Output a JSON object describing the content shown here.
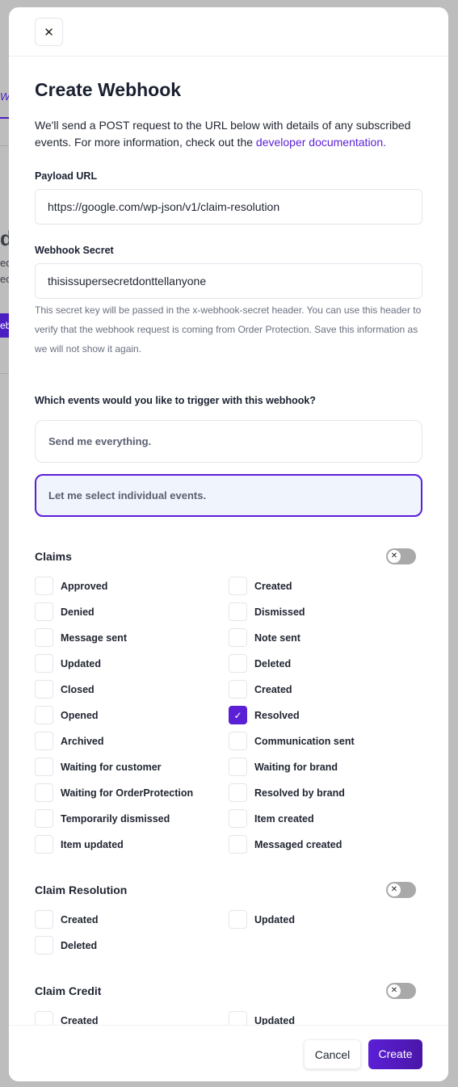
{
  "background": {
    "tab": "We",
    "heading": "d",
    "line1": "ed",
    "line2": "ec",
    "button": "eb"
  },
  "modal": {
    "close_icon": "close-icon",
    "title": "Create Webhook",
    "description": "We'll send a POST request to the URL below with details of any subscribed events. For more information, check out the ",
    "doc_link": "developer documentation.",
    "payload_label": "Payload URL",
    "payload_value": "https://google.com/wp-json/v1/claim-resolution",
    "secret_label": "Webhook Secret",
    "secret_value": "thisissupersecretdonttellanyone",
    "secret_help": "This secret key will be passed in the x-webhook-secret header. You can use this header to verify that the webhook request is coming from Order Protection. Save this information as we will not show it again.",
    "events_question": "Which events would you like to trigger with this webhook?",
    "option_all": "Send me everything.",
    "option_individual": "Let me select individual events.",
    "selected_option": "individual",
    "accent_color": "#5b1fd6",
    "sections": [
      {
        "title": "Claims",
        "toggle_on": false,
        "items": [
          {
            "label": "Approved",
            "checked": false
          },
          {
            "label": "Created",
            "checked": false
          },
          {
            "label": "Denied",
            "checked": false
          },
          {
            "label": "Dismissed",
            "checked": false
          },
          {
            "label": "Message sent",
            "checked": false
          },
          {
            "label": "Note sent",
            "checked": false
          },
          {
            "label": "Updated",
            "checked": false
          },
          {
            "label": "Deleted",
            "checked": false
          },
          {
            "label": "Closed",
            "checked": false
          },
          {
            "label": "Created",
            "checked": false
          },
          {
            "label": "Opened",
            "checked": false
          },
          {
            "label": "Resolved",
            "checked": true
          },
          {
            "label": "Archived",
            "checked": false
          },
          {
            "label": "Communication sent",
            "checked": false
          },
          {
            "label": "Waiting for customer",
            "checked": false
          },
          {
            "label": "Waiting for brand",
            "checked": false
          },
          {
            "label": "Waiting for OrderProtection",
            "checked": false
          },
          {
            "label": "Resolved by brand",
            "checked": false
          },
          {
            "label": "Temporarily dismissed",
            "checked": false
          },
          {
            "label": "Item created",
            "checked": false
          },
          {
            "label": "Item updated",
            "checked": false
          },
          {
            "label": "Messaged created",
            "checked": false
          }
        ]
      },
      {
        "title": "Claim Resolution",
        "toggle_on": false,
        "items": [
          {
            "label": "Created",
            "checked": false
          },
          {
            "label": "Updated",
            "checked": false
          },
          {
            "label": "Deleted",
            "checked": false
          }
        ]
      },
      {
        "title": "Claim Credit",
        "toggle_on": false,
        "items": [
          {
            "label": "Created",
            "checked": false
          },
          {
            "label": "Updated",
            "checked": false
          }
        ]
      }
    ],
    "cancel_label": "Cancel",
    "create_label": "Create"
  }
}
